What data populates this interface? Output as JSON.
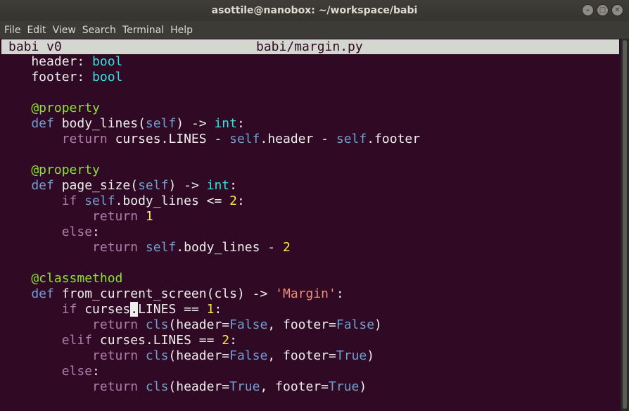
{
  "window": {
    "title": "asottile@nanobox: ~/workspace/babi",
    "controls": [
      {
        "name": "minimize-icon",
        "glyph": "–"
      },
      {
        "name": "maximize-icon",
        "glyph": "□"
      },
      {
        "name": "close-icon",
        "glyph": "✕"
      }
    ]
  },
  "menu": {
    "items": [
      "File",
      "Edit",
      "View",
      "Search",
      "Terminal",
      "Help"
    ]
  },
  "editor": {
    "app": "babi v0",
    "filename": "babi/margin.py",
    "cursor": {
      "line": 16,
      "column": 17
    }
  },
  "colors": {
    "background": "#300a24",
    "keyword": "#729fcf",
    "control": "#ad7fa8",
    "decorator": "#8ae234",
    "builtin": "#34e2e2",
    "number": "#fce94f",
    "string": "#ef8b79"
  },
  "code_lines": [
    [
      [
        "default",
        "    header: "
      ],
      [
        "builtin",
        "bool"
      ]
    ],
    [
      [
        "default",
        "    footer: "
      ],
      [
        "builtin",
        "bool"
      ]
    ],
    [],
    [
      [
        "decorator",
        "    @property"
      ]
    ],
    [
      [
        "keyword",
        "    def "
      ],
      [
        "default",
        "body_lines("
      ],
      [
        "keyword",
        "self"
      ],
      [
        "default",
        ") -> "
      ],
      [
        "builtin",
        "int"
      ],
      [
        "default",
        ":"
      ]
    ],
    [
      [
        "control",
        "        return "
      ],
      [
        "default",
        "curses.LINES - "
      ],
      [
        "keyword",
        "self"
      ],
      [
        "default",
        ".header - "
      ],
      [
        "keyword",
        "self"
      ],
      [
        "default",
        ".footer"
      ]
    ],
    [],
    [
      [
        "decorator",
        "    @property"
      ]
    ],
    [
      [
        "keyword",
        "    def "
      ],
      [
        "default",
        "page_size("
      ],
      [
        "keyword",
        "self"
      ],
      [
        "default",
        ") -> "
      ],
      [
        "builtin",
        "int"
      ],
      [
        "default",
        ":"
      ]
    ],
    [
      [
        "control",
        "        if "
      ],
      [
        "keyword",
        "self"
      ],
      [
        "default",
        ".body_lines <= "
      ],
      [
        "number",
        "2"
      ],
      [
        "default",
        ":"
      ]
    ],
    [
      [
        "control",
        "            return "
      ],
      [
        "number",
        "1"
      ]
    ],
    [
      [
        "control",
        "        else"
      ],
      [
        "default",
        ":"
      ]
    ],
    [
      [
        "control",
        "            return "
      ],
      [
        "keyword",
        "self"
      ],
      [
        "default",
        ".body_lines - "
      ],
      [
        "number",
        "2"
      ]
    ],
    [],
    [
      [
        "decorator",
        "    @classmethod"
      ]
    ],
    [
      [
        "keyword",
        "    def "
      ],
      [
        "default",
        "from_current_screen(cls) -> "
      ],
      [
        "string",
        "'Margin'"
      ],
      [
        "default",
        ":"
      ]
    ],
    [
      [
        "control",
        "        if "
      ],
      [
        "default",
        "curses.LINES == "
      ],
      [
        "number",
        "1"
      ],
      [
        "default",
        ":"
      ]
    ],
    [
      [
        "control",
        "            return "
      ],
      [
        "keyword",
        "cls"
      ],
      [
        "default",
        "(header="
      ],
      [
        "keyword",
        "False"
      ],
      [
        "default",
        ", footer="
      ],
      [
        "keyword",
        "False"
      ],
      [
        "default",
        ")"
      ]
    ],
    [
      [
        "control",
        "        elif "
      ],
      [
        "default",
        "curses.LINES == "
      ],
      [
        "number",
        "2"
      ],
      [
        "default",
        ":"
      ]
    ],
    [
      [
        "control",
        "            return "
      ],
      [
        "keyword",
        "cls"
      ],
      [
        "default",
        "(header="
      ],
      [
        "keyword",
        "False"
      ],
      [
        "default",
        ", footer="
      ],
      [
        "keyword",
        "True"
      ],
      [
        "default",
        ")"
      ]
    ],
    [
      [
        "control",
        "        else"
      ],
      [
        "default",
        ":"
      ]
    ],
    [
      [
        "control",
        "            return "
      ],
      [
        "keyword",
        "cls"
      ],
      [
        "default",
        "(header="
      ],
      [
        "keyword",
        "True"
      ],
      [
        "default",
        ", footer="
      ],
      [
        "keyword",
        "True"
      ],
      [
        "default",
        ")"
      ]
    ]
  ]
}
